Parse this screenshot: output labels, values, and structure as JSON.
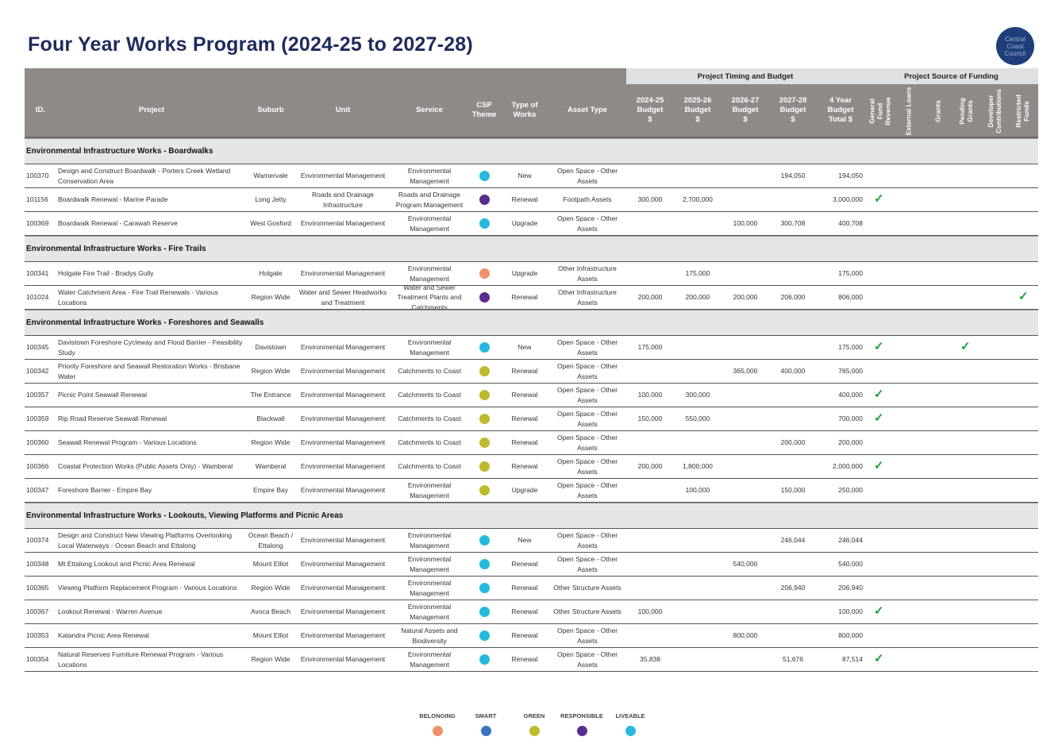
{
  "title": "Four Year Works Program (2024-25 to 2027-28)",
  "logo_text": "Central Coast Council",
  "groups": {
    "timing": "Project Timing and Budget",
    "funding": "Project Source of Funding"
  },
  "headers": {
    "id": "ID.",
    "project": "Project",
    "suburb": "Suburb",
    "unit": "Unit",
    "service": "Service",
    "csp_theme": "CSP Theme",
    "type_of_works": "Type of Works",
    "asset_type": "Asset Type",
    "b2425": "2024-25 Budget $",
    "b2526": "2025-26 Budget $",
    "b2627": "2026-27 Budget $",
    "b2728": "2027-28 Budget $",
    "total": "4 Year Budget Total $",
    "f_general": "General Fund Revenue",
    "f_loans": "External Loans",
    "f_grants": "Grants",
    "f_pending": "Pending Grants",
    "f_developer": "Developer Contributions",
    "f_restricted": "Restricted Funds"
  },
  "theme_colors": {
    "BELONGING": "#f0906a",
    "SMART": "#3a74c4",
    "GREEN": "#bdbb2e",
    "RESPONSIBLE": "#5b2d8e",
    "LIVEABLE": "#27b9dd"
  },
  "tick_glyph": "✓",
  "sections": [
    {
      "title": "Environmental Infrastructure Works - Boardwalks",
      "rows": [
        {
          "id": "100370",
          "project": "Design and Construct Boardwalk - Porters Creek Wetland Conservation Area",
          "suburb": "Warnervale",
          "unit": "Environmental Management",
          "service": "Environmental Management",
          "theme": "LIVEABLE",
          "type": "New",
          "asset": "Open Space - Other Assets",
          "b1": "",
          "b2": "",
          "b3": "",
          "b4": "194,050",
          "total": "194,050",
          "funds": []
        },
        {
          "id": "101156",
          "project": "Boardwalk Renewal - Marine Parade",
          "suburb": "Long Jetty",
          "unit": "Roads and Drainage Infrastructure",
          "service": "Roads and Drainage Program Management",
          "theme": "RESPONSIBLE",
          "type": "Renewal",
          "asset": "Footpath Assets",
          "b1": "300,000",
          "b2": "2,700,000",
          "b3": "",
          "b4": "",
          "total": "3,000,000",
          "funds": [
            "general"
          ]
        },
        {
          "id": "100369",
          "project": "Boardwalk Renewal - Carawah Reserve",
          "suburb": "West Gosford",
          "unit": "Environmental Management",
          "service": "Environmental Management",
          "theme": "LIVEABLE",
          "type": "Upgrade",
          "asset": "Open Space - Other Assets",
          "b1": "",
          "b2": "",
          "b3": "100,000",
          "b4": "300,708",
          "total": "400,708",
          "funds": []
        }
      ]
    },
    {
      "title": "Environmental Infrastructure Works - Fire Trails",
      "rows": [
        {
          "id": "100341",
          "project": "Holgate Fire Trail - Bradys Gully",
          "suburb": "Holgate",
          "unit": "Environmental Management",
          "service": "Environmental Management",
          "theme": "BELONGING",
          "type": "Upgrade",
          "asset": "Other Infrastructure Assets",
          "b1": "",
          "b2": "175,000",
          "b3": "",
          "b4": "",
          "total": "175,000",
          "funds": []
        },
        {
          "id": "101024",
          "project": "Water Catchment Area - Fire Trail Renewals - Various Locations",
          "suburb": "Region Wide",
          "unit": "Water and Sewer Headworks and Treatment",
          "service": "Water and Sewer Treatment Plants and Catchments",
          "theme": "RESPONSIBLE",
          "type": "Renewal",
          "asset": "Other Infrastructure Assets",
          "b1": "200,000",
          "b2": "200,000",
          "b3": "200,000",
          "b4": "206,000",
          "total": "806,000",
          "funds": [
            "restricted"
          ]
        }
      ]
    },
    {
      "title": "Environmental Infrastructure Works - Foreshores and Seawalls",
      "rows": [
        {
          "id": "100345",
          "project": "Davistown Foreshore Cycleway and Flood Barrier - Feasibility Study",
          "suburb": "Davistown",
          "unit": "Environmental Management",
          "service": "Environmental Management",
          "theme": "LIVEABLE",
          "type": "New",
          "asset": "Open Space - Other Assets",
          "b1": "175,000",
          "b2": "",
          "b3": "",
          "b4": "",
          "total": "175,000",
          "funds": [
            "general",
            "pending"
          ]
        },
        {
          "id": "100342",
          "project": "Priority Foreshore and Seawall Restoration Works - Brisbane Water",
          "suburb": "Region Wide",
          "unit": "Environmental Management",
          "service": "Catchments to Coast",
          "theme": "GREEN",
          "type": "Renewal",
          "asset": "Open Space - Other Assets",
          "b1": "",
          "b2": "",
          "b3": "365,000",
          "b4": "400,000",
          "total": "765,000",
          "funds": []
        },
        {
          "id": "100357",
          "project": "Picnic Point Seawall Renewal",
          "suburb": "The Entrance",
          "unit": "Environmental Management",
          "service": "Catchments to Coast",
          "theme": "GREEN",
          "type": "Renewal",
          "asset": "Open Space - Other Assets",
          "b1": "100,000",
          "b2": "300,000",
          "b3": "",
          "b4": "",
          "total": "400,000",
          "funds": [
            "general"
          ]
        },
        {
          "id": "100359",
          "project": "Rip Road Reserve Seawall Renewal",
          "suburb": "Blackwall",
          "unit": "Environmental Management",
          "service": "Catchments to Coast",
          "theme": "GREEN",
          "type": "Renewal",
          "asset": "Open Space - Other Assets",
          "b1": "150,000",
          "b2": "550,000",
          "b3": "",
          "b4": "",
          "total": "700,000",
          "funds": [
            "general"
          ]
        },
        {
          "id": "100360",
          "project": "Seawall Renewal Program - Various Locations",
          "suburb": "Region Wide",
          "unit": "Environmental Management",
          "service": "Catchments to Coast",
          "theme": "GREEN",
          "type": "Renewal",
          "asset": "Open Space - Other Assets",
          "b1": "",
          "b2": "",
          "b3": "",
          "b4": "200,000",
          "total": "200,000",
          "funds": []
        },
        {
          "id": "100366",
          "project": "Coastal Protection Works (Public Assets Only) - Wamberal",
          "suburb": "Wamberal",
          "unit": "Environmental Management",
          "service": "Catchments to Coast",
          "theme": "GREEN",
          "type": "Renewal",
          "asset": "Open Space - Other Assets",
          "b1": "200,000",
          "b2": "1,800,000",
          "b3": "",
          "b4": "",
          "total": "2,000,000",
          "funds": [
            "general"
          ]
        },
        {
          "id": "100347",
          "project": "Foreshore Barrier - Empire Bay",
          "suburb": "Empire Bay",
          "unit": "Environmental Management",
          "service": "Environmental Management",
          "theme": "GREEN",
          "type": "Upgrade",
          "asset": "Open Space - Other Assets",
          "b1": "",
          "b2": "100,000",
          "b3": "",
          "b4": "150,000",
          "total": "250,000",
          "funds": []
        }
      ]
    },
    {
      "title": "Environmental Infrastructure Works - Lookouts, Viewing Platforms and Picnic Areas",
      "rows": [
        {
          "id": "100374",
          "project": "Design and Construct New Viewing Platforms Overlooking Local Waterways - Ocean Beach and Ettalong",
          "suburb": "Ocean Beach / Ettalong",
          "unit": "Environmental Management",
          "service": "Environmental Management",
          "theme": "LIVEABLE",
          "type": "New",
          "asset": "Open Space - Other Assets",
          "b1": "",
          "b2": "",
          "b3": "",
          "b4": "246,044",
          "total": "246,044",
          "funds": []
        },
        {
          "id": "100348",
          "project": "Mt Ettalong Lookout and Picnic Area Renewal",
          "suburb": "Mount Elliot",
          "unit": "Environmental Management",
          "service": "Environmental Management",
          "theme": "LIVEABLE",
          "type": "Renewal",
          "asset": "Open Space - Other Assets",
          "b1": "",
          "b2": "",
          "b3": "540,000",
          "b4": "",
          "total": "540,000",
          "funds": []
        },
        {
          "id": "100365",
          "project": "Viewing Platform Replacement Program - Various Locations",
          "suburb": "Region Wide",
          "unit": "Environmental Management",
          "service": "Environmental Management",
          "theme": "LIVEABLE",
          "type": "Renewal",
          "asset": "Other Structure Assets",
          "b1": "",
          "b2": "",
          "b3": "",
          "b4": "206,940",
          "total": "206,940",
          "funds": []
        },
        {
          "id": "100367",
          "project": "Lookout Renewal - Warren Avenue",
          "suburb": "Avoca Beach",
          "unit": "Environmental Management",
          "service": "Environmental Management",
          "theme": "LIVEABLE",
          "type": "Renewal",
          "asset": "Other Structure Assets",
          "b1": "100,000",
          "b2": "",
          "b3": "",
          "b4": "",
          "total": "100,000",
          "funds": [
            "general"
          ]
        },
        {
          "id": "100353",
          "project": "Katandra Picnic Area Renewal",
          "suburb": "Mount Elliot",
          "unit": "Environmental Management",
          "service": "Natural Assets and Biodiversity",
          "theme": "LIVEABLE",
          "type": "Renewal",
          "asset": "Open Space - Other Assets",
          "b1": "",
          "b2": "",
          "b3": "800,000",
          "b4": "",
          "total": "800,000",
          "funds": []
        },
        {
          "id": "100354",
          "project": "Natural Reserves Furniture Renewal Program - Various Locations",
          "suburb": "Region Wide",
          "unit": "Environmental Management",
          "service": "Environmental Management",
          "theme": "LIVEABLE",
          "type": "Renewal",
          "asset": "Open Space - Other Assets",
          "b1": "35,838",
          "b2": "",
          "b3": "",
          "b4": "51,676",
          "total": "87,514",
          "funds": [
            "general"
          ]
        }
      ]
    }
  ],
  "legend": [
    {
      "label": "BELONGING",
      "theme": "BELONGING"
    },
    {
      "label": "SMART",
      "theme": "SMART"
    },
    {
      "label": "GREEN",
      "theme": "GREEN"
    },
    {
      "label": "RESPONSIBLE",
      "theme": "RESPONSIBLE"
    },
    {
      "label": "LIVEABLE",
      "theme": "LIVEABLE"
    }
  ]
}
